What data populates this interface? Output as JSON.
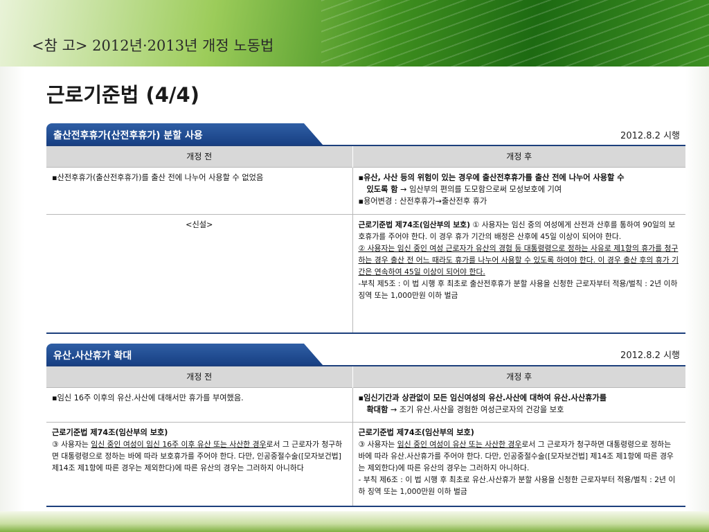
{
  "header": {
    "ref_title": "<참 고> 2012년·2013년 개정 노동법"
  },
  "page_title": "근로기준법 (4/4)",
  "columns": {
    "before": "개정 전",
    "after": "개정 후"
  },
  "section1": {
    "title": "출산전후휴가(산전후휴가) 분할 사용",
    "date": "2012.8.2 시행",
    "row1": {
      "before": "▪산전후휴가(출산전후휴가)를 출산 전에 나누어 사용할 수 없었음",
      "after_bold_1": "▪유산, 사산 등의 위험이 있는 경우에 출산전후휴가를 출산 전에 나누어 사용할 수",
      "after_bold_2": "있도록 함",
      "after_arrow_rest": " → 임산부의 편의를 도모함으로써 모성보호에 기여",
      "after_line3": "▪용어변경 : 산전후휴가→출산전후 휴가"
    },
    "row2": {
      "before": "<신설>",
      "after_head_bold": "근로기준법 제74조(임산부의 보호)",
      "after_p1": " ① 사용자는 임신 중의 여성에게 산전과 산후를 통하여 90일의 보호휴가를 주어야 한다. 이 경우 휴가 기간의 배정은 산후에 45일 이상이 되어야 한다.",
      "after_p2": "② 사용자는 임신 중인 여성 근로자가 유산의 경험 등 대통령령으로 정하는 사유로 제1항의 휴가를 청구하는 경우 출산 전 어느 때라도 휴가를 나누어 사용할 수 있도록 하여야 한다. 이 경우 출산 후의 휴가 기간은 연속하여 45일 이상이 되어야 한다.",
      "after_p3": "-부칙 제5조 : 이 법 시행 후 최초로 출산전후휴가 분할 사용을 신청한 근로자부터 적용/벌칙 : 2년 이하 징역 또는 1,000만원 이하 벌금"
    }
  },
  "section2": {
    "title": "유산.사산휴가 확대",
    "date": "2012.8.2 시행",
    "row1": {
      "before": "▪임신 16주 이후의 유산.사산에 대해서만 휴가를 부여했음.",
      "after_bold_1": "▪임신기간과 상관없이 모든 임신여성의 유산.사산에 대하여 유산.사산휴가를",
      "after_bold_2": "확대함",
      "after_arrow_rest": " → 조기 유산.사산을 경험한 여성근로자의 건강을 보호"
    },
    "row2": {
      "before_head": "근로기준법 제74조(임산부의 보호)",
      "before_p1_a": "③ 사용자는 ",
      "before_p1_u": "임신 중인 여성이 임신 16주 이후 유산 또는 사산한 경우",
      "before_p1_b": "로서 그 근로자가 청구하면 대통령령으로 정하는 바에 따라 보호휴가를 주어야 한다. 다만, 인공중절수술([모자보건법] 제14조 제1항에 따른 경우는 제외한다)에 따른 유산의 경우는 그러하지 아니하다",
      "after_head": "근로기준법 제74조(임산부의 보호)",
      "after_p1_a": "③ 사용자는 ",
      "after_p1_u": "임신 중인 여성이 유산 또는 사산한 경우",
      "after_p1_b": "로서 그 근로자가 청구하면 대통령령으로 정하는 바에 따라 유산.사산휴가를 주어야 한다. 다만, 인공중절수술([모자보건법] 제14조 제1항에 따른 경우는 제외한다)에 따른 유산의 경우는 그러하지 아니하다.",
      "after_p2": "- 부칙 제6조 : 이 법 시행 후 최초로 유산.사산휴가 분할 사용을 신청한 근로자부터 적용/벌칙 : 2년 이하 징역 또는 1,000만원 이하 벌금"
    }
  }
}
